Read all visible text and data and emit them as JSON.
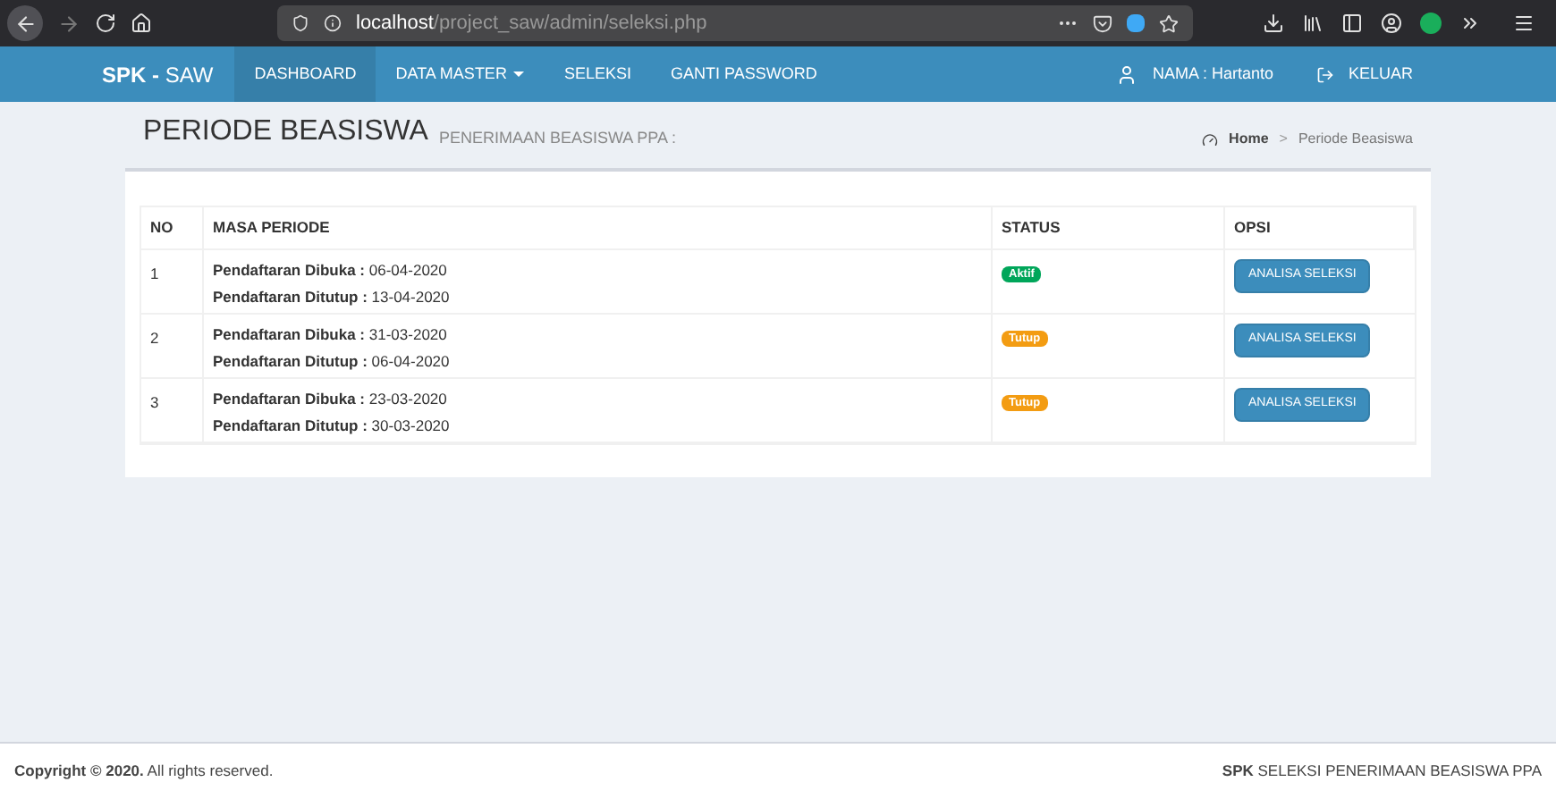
{
  "browser": {
    "url_host": "localhost",
    "url_path": "/project_saw/admin/seleksi.php"
  },
  "navbar": {
    "brand_bold": "SPK -",
    "brand_rest": "SAW",
    "items": [
      {
        "label": "DASHBOARD",
        "selected": true,
        "dropdown": false
      },
      {
        "label": "DATA MASTER",
        "selected": false,
        "dropdown": true
      },
      {
        "label": "SELEKSI",
        "selected": false,
        "dropdown": false
      },
      {
        "label": "GANTI PASSWORD",
        "selected": false,
        "dropdown": false
      }
    ],
    "user": "NAMA : Hartanto",
    "logout": "KELUAR"
  },
  "header": {
    "title": "PERIODE BEASISWA",
    "subtitle": "PENERIMAAN BEASISWA PPA :",
    "breadcrumb": [
      "Home",
      "Periode Beasiswa"
    ],
    "breadcrumb_separator": ">"
  },
  "table": {
    "columns": [
      "NO",
      "MASA PERIODE",
      "STATUS",
      "OPSI"
    ],
    "rows": [
      {
        "no": "1",
        "lines": [
          "**Pendaftaran Dibuka :** 06-04-2020",
          "**Pendaftaran Ditutup :** 13-04-2020"
        ],
        "status": {
          "label": "Aktif",
          "kind": "success"
        },
        "action": "ANALISA SELEKSI"
      },
      {
        "no": "2",
        "lines": [
          "**Pendaftaran Dibuka :** 31-03-2020",
          "**Pendaftaran Ditutup :** 06-04-2020"
        ],
        "status": {
          "label": "Tutup",
          "kind": "warning"
        },
        "action": "ANALISA SELEKSI"
      },
      {
        "no": "3",
        "lines": [
          "**Pendaftaran Dibuka :** 23-03-2020",
          "**Pendaftaran Ditutup :** 30-03-2020"
        ],
        "status": {
          "label": "Tutup",
          "kind": "warning"
        },
        "action": "ANALISA SELEKSI"
      }
    ]
  },
  "footer": {
    "left": "**Copyright © 2020.** All rights reserved.",
    "right": "**SPK** SELEKSI PENERIMAAN BEASISWA PPA"
  }
}
